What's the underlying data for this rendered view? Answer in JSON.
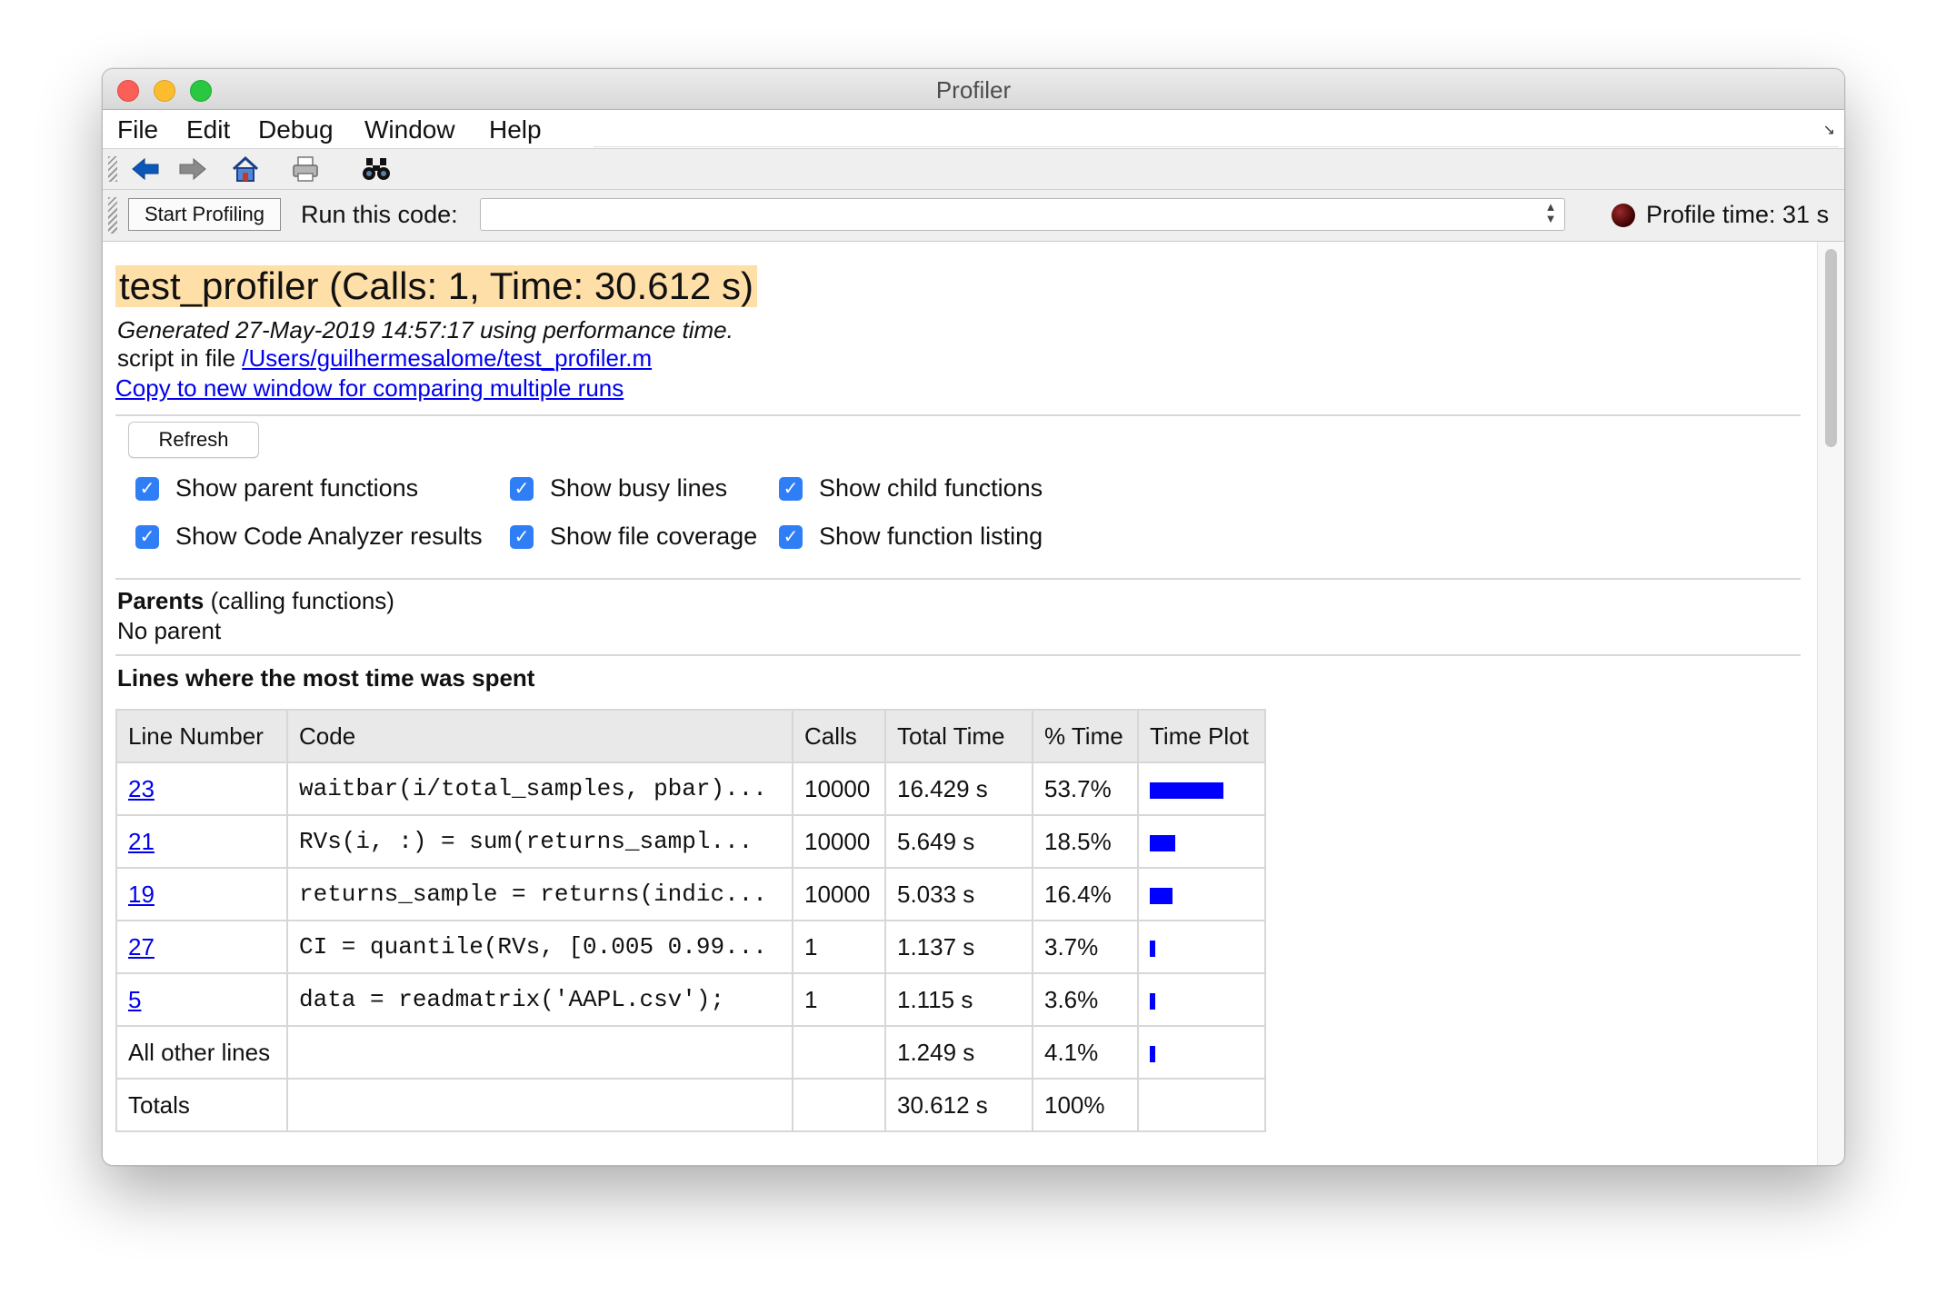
{
  "window": {
    "title": "Profiler"
  },
  "menu": [
    "File",
    "Edit",
    "Debug",
    "Window",
    "Help"
  ],
  "toolbar": {
    "icons": [
      "back-arrow-icon",
      "forward-arrow-icon",
      "home-icon",
      "print-icon",
      "binoculars-icon"
    ]
  },
  "profile_bar": {
    "start_button": "Start Profiling",
    "run_label": "Run this code:",
    "run_value": "",
    "profile_time": "Profile time: 31 s"
  },
  "report": {
    "title": "test_profiler (Calls: 1, Time: 30.612 s)",
    "generated": "Generated 27-May-2019 14:57:17 using performance time.",
    "script_prefix": "script in file ",
    "script_path": "/Users/guilhermesalome/test_profiler.m",
    "copy_link": "Copy to new window for comparing multiple runs",
    "refresh": "Refresh",
    "checkboxes": [
      {
        "label": "Show parent functions",
        "checked": true
      },
      {
        "label": "Show busy lines",
        "checked": true
      },
      {
        "label": "Show child functions",
        "checked": true
      },
      {
        "label": "Show Code Analyzer results",
        "checked": true
      },
      {
        "label": "Show file coverage",
        "checked": true
      },
      {
        "label": "Show function listing",
        "checked": true
      }
    ],
    "parents_heading": "Parents",
    "parents_sub": "(calling functions)",
    "parents_value": "No parent",
    "lines_heading": "Lines where the most time was spent",
    "table": {
      "headers": [
        "Line Number",
        "Code",
        "Calls",
        "Total Time",
        "% Time",
        "Time Plot"
      ],
      "rows": [
        {
          "line": "23",
          "code": "waitbar(i/total_samples, pbar)...",
          "calls": "10000",
          "total": "16.429 s",
          "pct": "53.7%",
          "frac": 0.537,
          "link": true
        },
        {
          "line": "21",
          "code": "RVs(i, :)  = sum(returns_sampl...",
          "calls": "10000",
          "total": "5.649 s",
          "pct": "18.5%",
          "frac": 0.185,
          "link": true
        },
        {
          "line": "19",
          "code": "returns_sample = returns(indic...",
          "calls": "10000",
          "total": "5.033 s",
          "pct": "16.4%",
          "frac": 0.164,
          "link": true
        },
        {
          "line": "27",
          "code": "CI = quantile(RVs, [0.005 0.99...",
          "calls": "1",
          "total": "1.137 s",
          "pct": "3.7%",
          "frac": 0.037,
          "link": true
        },
        {
          "line": "5",
          "code": "data = readmatrix('AAPL.csv');",
          "calls": "1",
          "total": "1.115 s",
          "pct": "3.6%",
          "frac": 0.036,
          "link": true
        },
        {
          "line": "All other lines",
          "code": "",
          "calls": "",
          "total": "1.249 s",
          "pct": "4.1%",
          "frac": 0.041,
          "link": false
        },
        {
          "line": "Totals",
          "code": "",
          "calls": "",
          "total": "30.612 s",
          "pct": "100%",
          "frac": null,
          "link": false
        }
      ]
    }
  }
}
